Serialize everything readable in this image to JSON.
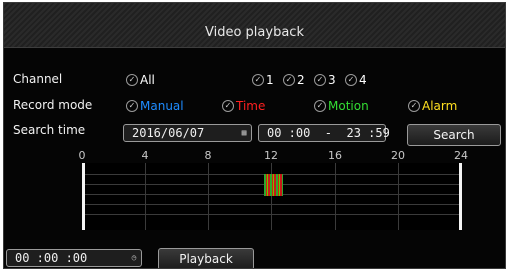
{
  "title": "Video playback",
  "channel": {
    "label": "Channel",
    "options": [
      {
        "text": "All",
        "checked": true
      },
      {
        "text": "1",
        "checked": true
      },
      {
        "text": "2",
        "checked": true
      },
      {
        "text": "3",
        "checked": true
      },
      {
        "text": "4",
        "checked": true
      }
    ]
  },
  "record_mode": {
    "label": "Record mode",
    "options": [
      {
        "text": "Manual",
        "color": "#1e8cff",
        "checked": true
      },
      {
        "text": "Time",
        "color": "#ff2020",
        "checked": true
      },
      {
        "text": "Motion",
        "color": "#33dd33",
        "checked": true
      },
      {
        "text": "Alarm",
        "color": "#ffe020",
        "checked": true
      }
    ]
  },
  "search_time": {
    "label": "Search time",
    "date": "2016/06/07",
    "range": "00 :00  -  23 :59",
    "search_label": "Search"
  },
  "timeline": {
    "hour_labels": [
      "0",
      "4",
      "8",
      "12",
      "16",
      "20",
      "24"
    ],
    "records": [
      {
        "start_hour": 11.5,
        "end_hour": 12.7,
        "row": 0
      },
      {
        "start_hour": 11.5,
        "end_hour": 12.7,
        "row": 1
      }
    ]
  },
  "playback": {
    "time": "00 :00 :00",
    "label": "Playback"
  },
  "icons": {
    "checkbox": "check-circle-icon",
    "calendar": "calendar-icon",
    "clock": "clock-icon"
  }
}
